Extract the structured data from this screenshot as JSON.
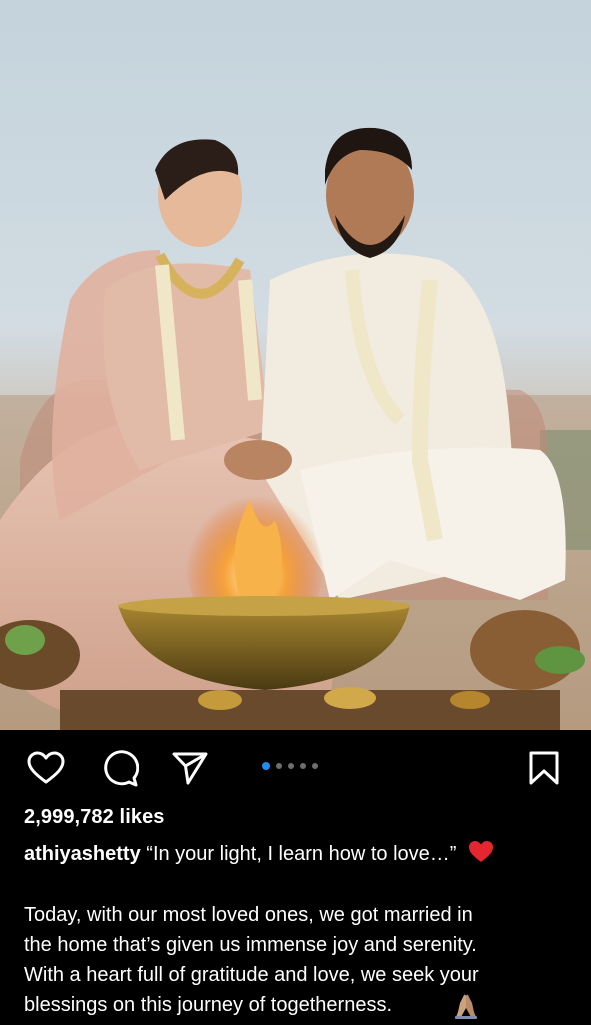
{
  "post": {
    "likes": "2,999,782 likes",
    "username": "athiyashetty",
    "caption_title": "“In your light, I learn how to love…”",
    "caption_body": "Today, with our most loved ones, we got married in\nthe home that’s given us immense joy and serenity.\nWith a heart full of gratitude and love, we seek your\nblessings on this journey of togetherness.",
    "carousel": {
      "total": 5,
      "current": 1
    }
  },
  "icons": {
    "like": "heart-outline-icon",
    "comment": "comment-bubble-icon",
    "share": "paper-plane-icon",
    "save": "bookmark-icon",
    "caption_emoji": "red-heart-emoji",
    "end_emoji": "praying-hands-emoji"
  },
  "colors": {
    "background": "#000000",
    "text": "#ffffff",
    "active_dot": "#1f8ef1",
    "inactive_dot": "#6e6e6e",
    "heart_emoji": "#e3262f"
  }
}
